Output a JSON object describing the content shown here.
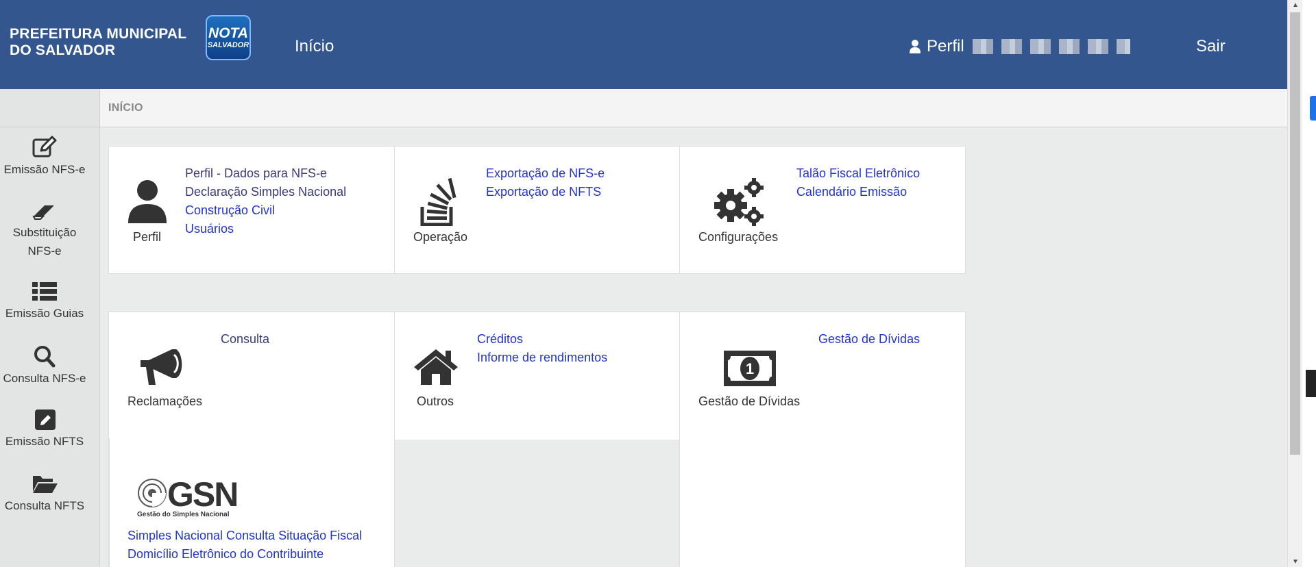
{
  "header": {
    "brand_line1": "PREFEITURA MUNICIPAL",
    "brand_line2": "DO SALVADOR",
    "logo_line1": "NOTA",
    "logo_line2": "SALVADOR",
    "nav_inicio": "Início",
    "perfil_label": "Perfil",
    "sair_label": "Sair"
  },
  "breadcrumb": {
    "label": "INÍCIO"
  },
  "sidebar": {
    "items": [
      {
        "label": "Emissão NFS-e",
        "icon": "edit-icon"
      },
      {
        "label": "Substituição NFS-e",
        "icon": "eraser-icon"
      },
      {
        "label": "Emissão Guias",
        "icon": "list-icon"
      },
      {
        "label": "Consulta NFS-e",
        "icon": "search-icon"
      },
      {
        "label": "Emissão NFTS",
        "icon": "pencil-square-icon"
      },
      {
        "label": "Consulta NFTS",
        "icon": "folder-open-icon"
      }
    ]
  },
  "cards": {
    "perfil": {
      "title": "Perfil",
      "links": [
        "Perfil - Dados para NFS-e",
        "Declaração Simples Nacional",
        "Construção Civil",
        "Usuários"
      ]
    },
    "operacao": {
      "title": "Operação",
      "links": [
        "Exportação de NFS-e",
        "Exportação de NFTS"
      ]
    },
    "configuracoes": {
      "title": "Configurações",
      "links": [
        "Talão Fiscal Eletrônico",
        "Calendário Emissão"
      ]
    },
    "reclamacoes": {
      "title": "Reclamações",
      "links": [
        "Consulta"
      ]
    },
    "outros": {
      "title": "Outros",
      "links": [
        "Créditos",
        "Informe de rendimentos"
      ]
    },
    "dividas": {
      "title": "Gestão de Dívidas",
      "links": [
        "Gestão de Dívidas"
      ]
    },
    "gsn": {
      "logo_text": "GSN",
      "logo_caption": "Gestão do Simples Nacional",
      "links": [
        "Simples Nacional Consulta Situação Fiscal",
        "Domicílio Eletrônico do Contribuinte"
      ]
    }
  },
  "colors": {
    "header_bg": "#33568e",
    "link": "#2233cc"
  }
}
